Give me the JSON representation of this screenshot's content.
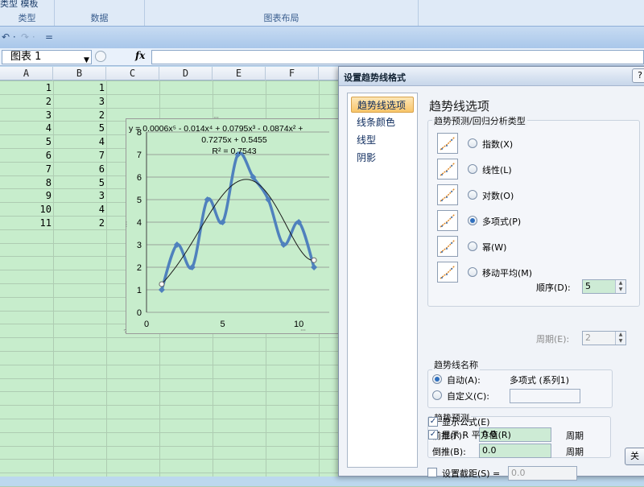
{
  "ribbon": {
    "top_left": "类型  模板",
    "groups": [
      {
        "label": "类型"
      },
      {
        "label": "数据"
      },
      {
        "label": "图表布局"
      }
    ]
  },
  "qat": {
    "undo": "↶ ·",
    "redo": "↷ ·",
    "more": "="
  },
  "namebox": {
    "value": "图表 1",
    "arrow": "▼"
  },
  "formula": {
    "fx": "fx",
    "value": ""
  },
  "sheet": {
    "columns": [
      "A",
      "B",
      "C",
      "D",
      "E",
      "F"
    ],
    "rows": [
      {
        "a": "1",
        "b": "1"
      },
      {
        "a": "2",
        "b": "3"
      },
      {
        "a": "3",
        "b": "2"
      },
      {
        "a": "4",
        "b": "5"
      },
      {
        "a": "5",
        "b": "4"
      },
      {
        "a": "6",
        "b": "7"
      },
      {
        "a": "7",
        "b": "6"
      },
      {
        "a": "8",
        "b": "5"
      },
      {
        "a": "9",
        "b": "3"
      },
      {
        "a": "10",
        "b": "4"
      },
      {
        "a": "11",
        "b": "2"
      }
    ]
  },
  "chart": {
    "equation_line1": "y = 0.0006x⁵ - 0.014x⁴ + 0.0795x³ - 0.0874x² +",
    "equation_line2": "0.7275x + 0.5455",
    "r_squared": "R² = 0.7543",
    "series_color": "#4f81bd",
    "trend_color": "#1a1a1a"
  },
  "chart_data": {
    "type": "scatter",
    "x": [
      1,
      2,
      3,
      4,
      5,
      6,
      7,
      8,
      9,
      10,
      11
    ],
    "series": [
      {
        "values": [
          1,
          3,
          2,
          5,
          4,
          7,
          6,
          5,
          3,
          4,
          2
        ]
      }
    ],
    "trendline": {
      "type": "polynomial",
      "order": 5,
      "x_start": 1,
      "x_end": 11
    },
    "xlim": [
      0,
      12
    ],
    "ylim": [
      0,
      8
    ],
    "x_ticks": [
      0,
      5,
      10
    ],
    "y_ticks": [
      0,
      1,
      2,
      3,
      4,
      5,
      6,
      7,
      8
    ],
    "grid": true,
    "title": "",
    "xlabel": "",
    "ylabel": ""
  },
  "dialog": {
    "title": "设置趋势线格式",
    "help": "?",
    "nav": [
      "趋势线选项",
      "线条颜色",
      "线型",
      "阴影"
    ],
    "section_title": "趋势线选项",
    "type_group_title": "趋势预测/回归分析类型",
    "types": [
      {
        "label": "指数(X)",
        "selected": false
      },
      {
        "label": "线性(L)",
        "selected": false
      },
      {
        "label": "对数(O)",
        "selected": false
      },
      {
        "label": "多项式(P)",
        "selected": true
      },
      {
        "label": "幂(W)",
        "selected": false
      },
      {
        "label": "移动平均(M)",
        "selected": false
      }
    ],
    "order_label": "顺序(D):",
    "order_value": "5",
    "period_label": "周期(E):",
    "period_value": "2",
    "name_group_title": "趋势线名称",
    "auto_label": "自动(A):",
    "auto_value": "多项式 (系列1)",
    "custom_label": "自定义(C):",
    "custom_value": "",
    "forecast_group_title": "趋势预测",
    "forward_label": "前推(F):",
    "forward_value": "0.0",
    "forward_unit": "周期",
    "backward_label": "倒推(B):",
    "backward_value": "0.0",
    "backward_unit": "周期",
    "intercept_label": "设置截距(S) =",
    "intercept_value": "0.0",
    "show_eq_label": "显示公式(E)",
    "show_r2_label": "显示 R 平方值(R)",
    "check_mark": "✓",
    "close_label": "关"
  }
}
